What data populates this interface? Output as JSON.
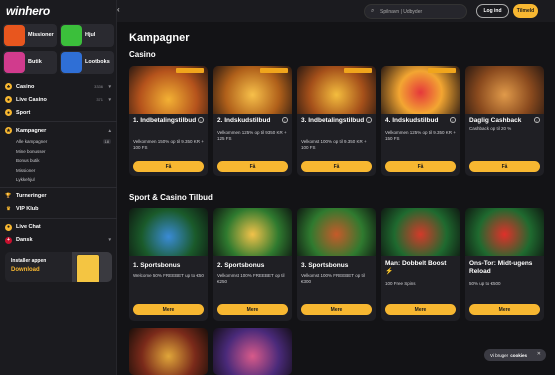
{
  "brand": {
    "logo": "winhero",
    "accent": "#f7b731"
  },
  "topbar": {
    "search_placeholder": "Spilnavn | Udbyder",
    "login_label": "Log ind",
    "signup_label": "Tilmeld"
  },
  "sidebar": {
    "tiles": [
      {
        "label": "Missioner",
        "color": "#e8561e"
      },
      {
        "label": "Hjul",
        "color": "#3bbf3b"
      },
      {
        "label": "Butik",
        "color": "#d13b8d"
      },
      {
        "label": "Lootboks",
        "color": "#2f6fd6"
      }
    ],
    "items": [
      {
        "label": "Casino",
        "count": "3336"
      },
      {
        "label": "Live Casino",
        "count": "371"
      },
      {
        "label": "Sport"
      },
      {
        "label": "Kampagner"
      }
    ],
    "sub_items": [
      {
        "label": "Alle kampagner",
        "badge": "18"
      },
      {
        "label": "Mine bonusser"
      },
      {
        "label": "Bonus butik"
      },
      {
        "label": "Missioner"
      },
      {
        "label": "Lykkehjul"
      }
    ],
    "lower_items": [
      {
        "label": "Turneringer"
      },
      {
        "label": "VIP Klub"
      }
    ],
    "bottom_items": [
      {
        "label": "Live Chat"
      },
      {
        "label": "Dansk"
      }
    ],
    "install": {
      "text": "Installer appen",
      "download": "Download",
      "phone_label": "winhero"
    }
  },
  "main": {
    "title": "Kampagner",
    "casino_title": "Casino",
    "casino_cards": [
      {
        "title": "1. Indbetalingstilbud",
        "desc": "Velkommen 150% op til 9.350 KR + 100 FS",
        "button": "Få"
      },
      {
        "title": "2. Indskudstilbud",
        "desc": "Velkommen 125% op til 9350 KR + 125 FS",
        "button": "Få"
      },
      {
        "title": "3. Indbetalingstilbud",
        "desc": "Velkomst 100% op til 9.350 KR + 100 FS",
        "button": "Få"
      },
      {
        "title": "4. Indskudstilbud",
        "desc": "Velkommen 125% op til 9.350 KR + 150 FS",
        "button": "Få"
      },
      {
        "title": "Daglig Cashback",
        "desc": "Cashback op til 20 %",
        "button": "Få"
      }
    ],
    "sport_title": "Sport & Casino Tilbud",
    "sport_cards": [
      {
        "title": "1. Sportsbonus",
        "desc": "Welcome 50% FREEBET up to €50",
        "button": "Mere"
      },
      {
        "title": "2. Sportsbonus",
        "desc": "Velkommst 100% FREEBET op til €250",
        "button": "Mere"
      },
      {
        "title": "3. Sportsbonus",
        "desc": "Velkomst 100% FREEBET op til €300",
        "button": "Mere"
      },
      {
        "title": "Man: Dobbelt Boost ⚡",
        "desc": "100 Free Spins",
        "button": "Mere"
      },
      {
        "title": "Ons-Tor: Midt-ugens Reload",
        "desc": "50% up to €500",
        "button": "Mere"
      }
    ]
  },
  "cookie": {
    "text": "Vi bruger",
    "bold": "cookies"
  }
}
